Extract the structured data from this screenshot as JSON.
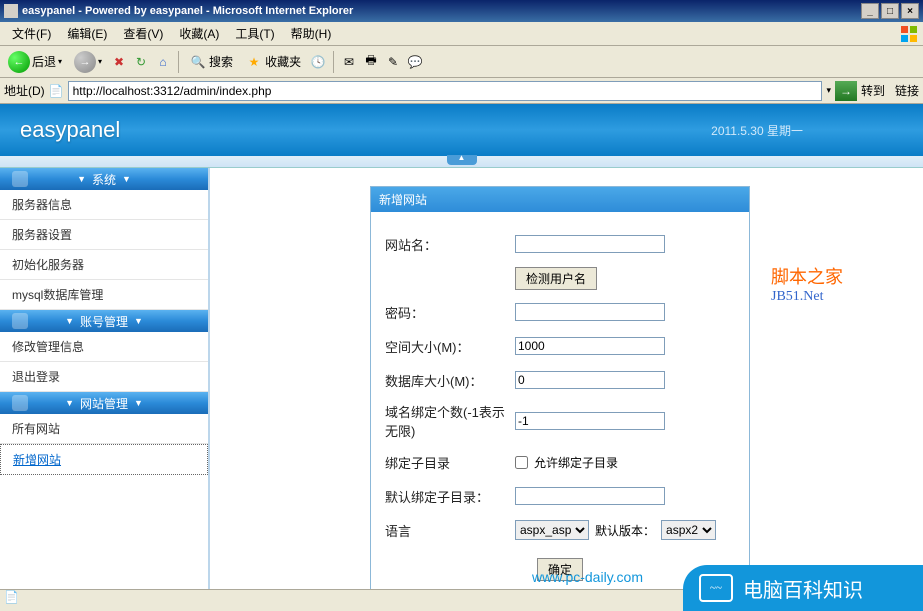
{
  "window": {
    "title": "easypanel - Powered by easypanel - Microsoft Internet Explorer",
    "min": "_",
    "max": "□",
    "close": "×"
  },
  "menu": {
    "file": "文件(F)",
    "edit": "编辑(E)",
    "view": "查看(V)",
    "fav": "收藏(A)",
    "tools": "工具(T)",
    "help": "帮助(H)"
  },
  "toolbar": {
    "back": "后退",
    "search": "搜索",
    "favorites": "收藏夹"
  },
  "address": {
    "label": "地址(D)",
    "value": "http://localhost:3312/admin/index.php",
    "go": "转到",
    "links": "链接"
  },
  "header": {
    "logo": "easypanel",
    "date": "2011.5.30 星期一"
  },
  "sidebar": {
    "sections": [
      {
        "title": "系统",
        "items": [
          "服务器信息",
          "服务器设置",
          "初始化服务器",
          "mysql数据库管理"
        ]
      },
      {
        "title": "账号管理",
        "items": [
          "修改管理信息",
          "退出登录"
        ]
      },
      {
        "title": "网站管理",
        "items": [
          "所有网站",
          "新增网站"
        ]
      }
    ]
  },
  "form": {
    "title": "新增网站",
    "site_name_label": "网站名：",
    "check_user_btn": "检测用户名",
    "password_label": "密码：",
    "space_label": "空间大小(M)：",
    "space_value": "1000",
    "db_label": "数据库大小(M)：",
    "db_value": "0",
    "domain_label": "域名绑定个数(-1表示无限)",
    "domain_value": "-1",
    "subdir_label": "绑定子目录",
    "subdir_check": "允许绑定子目录",
    "default_subdir_label": "默认绑定子目录：",
    "lang_label": "语言",
    "lang_value": "aspx_asp",
    "default_ver_label": "默认版本：",
    "default_ver_value": "aspx2",
    "submit": "确定"
  },
  "watermark": {
    "line1": "脚本之家",
    "line2": "JB51.Net"
  },
  "footer": {
    "url": "www.pc-daily.com",
    "brand": "电脑百科知识"
  }
}
